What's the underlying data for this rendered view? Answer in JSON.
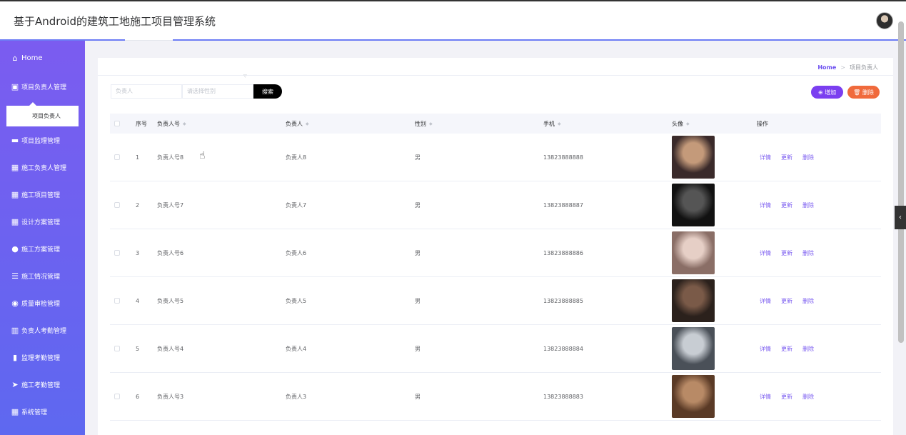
{
  "app": {
    "title": "基于Android的建筑工地施工项目管理系统"
  },
  "sidebar": {
    "items": [
      {
        "label": "Home",
        "icon": "home-icon",
        "glyph": "⌂"
      },
      {
        "label": "项目负责人管理",
        "icon": "clipboard-icon",
        "glyph": "▣"
      },
      {
        "label": "项目监理管理",
        "icon": "briefcase-icon",
        "glyph": "▬"
      },
      {
        "label": "施工负责人管理",
        "icon": "grid-icon",
        "glyph": "▦"
      },
      {
        "label": "施工项目管理",
        "icon": "grid-icon",
        "glyph": "▦"
      },
      {
        "label": "设计方案管理",
        "icon": "grid-icon",
        "glyph": "▦"
      },
      {
        "label": "施工方案管理",
        "icon": "user-icon",
        "glyph": "●"
      },
      {
        "label": "施工情况管理",
        "icon": "list-icon",
        "glyph": "☰"
      },
      {
        "label": "质量审检管理",
        "icon": "bulb-icon",
        "glyph": "◉"
      },
      {
        "label": "负责人考勤管理",
        "icon": "book-icon",
        "glyph": "▥"
      },
      {
        "label": "监理考勤管理",
        "icon": "bar-chart-icon",
        "glyph": "▮"
      },
      {
        "label": "施工考勤管理",
        "icon": "send-icon",
        "glyph": "➤"
      },
      {
        "label": "系统管理",
        "icon": "grid-icon",
        "glyph": "▦"
      }
    ],
    "sub_item": "项目负责人"
  },
  "breadcrumb": {
    "home": "Home",
    "separator": ">",
    "current": "项目负责人"
  },
  "search": {
    "name_placeholder": "负责人",
    "gender_placeholder": "请选择性别",
    "button": "搜索"
  },
  "actions": {
    "add": "增加",
    "delete": "删除"
  },
  "table": {
    "headers": [
      "序号",
      "负责人号",
      "负责人",
      "性别",
      "手机",
      "头像",
      "操作"
    ],
    "row_actions": [
      "详情",
      "更新",
      "删除"
    ],
    "rows": [
      {
        "index": "1",
        "code": "负责人号8",
        "name": "负责人8",
        "gender": "男",
        "phone": "13823888888",
        "photo_colors": [
          "#3a2a2a",
          "#c49a7a"
        ]
      },
      {
        "index": "2",
        "code": "负责人号7",
        "name": "负责人7",
        "gender": "男",
        "phone": "13823888887",
        "photo_colors": [
          "#111111",
          "#555555"
        ]
      },
      {
        "index": "3",
        "code": "负责人号6",
        "name": "负责人6",
        "gender": "男",
        "phone": "13823888886",
        "photo_colors": [
          "#8a6e66",
          "#e6cfc6"
        ]
      },
      {
        "index": "4",
        "code": "负责人号5",
        "name": "负责人5",
        "gender": "男",
        "phone": "13823888885",
        "photo_colors": [
          "#2b211c",
          "#7a5a48"
        ]
      },
      {
        "index": "5",
        "code": "负责人号4",
        "name": "负责人4",
        "gender": "男",
        "phone": "13823888884",
        "photo_colors": [
          "#4a5058",
          "#c8cdd3"
        ]
      },
      {
        "index": "6",
        "code": "负责人号3",
        "name": "负责人3",
        "gender": "男",
        "phone": "13823888883",
        "photo_colors": [
          "#5a3a26",
          "#b88a66"
        ]
      }
    ]
  },
  "colors": {
    "sidebar_top": "#7b5cf0",
    "sidebar_bottom": "#5e68f0",
    "add_button": "#7b3ff0",
    "delete_button": "#f06a3c",
    "link": "#7b5cf0"
  }
}
